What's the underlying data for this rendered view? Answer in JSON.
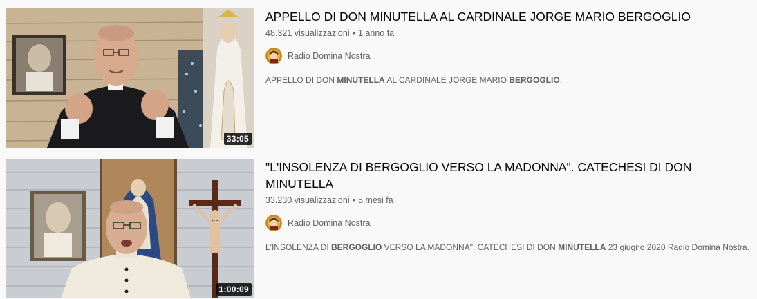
{
  "results": [
    {
      "title": "APPELLO DI DON MINUTELLA AL CARDINALE JORGE MARIO BERGOGLIO",
      "views": "48.321 visualizzazioni",
      "age": "1 anno fa",
      "separator": "•",
      "channel": "Radio Domina Nostra",
      "duration": "33:05",
      "description": [
        {
          "text": "APPELLO DI DON ",
          "bold": false
        },
        {
          "text": "MINUTELLA",
          "bold": true
        },
        {
          "text": " AL CARDINALE JORGE MARIO ",
          "bold": false
        },
        {
          "text": "BERGOGLIO",
          "bold": true
        },
        {
          "text": ".",
          "bold": false
        }
      ]
    },
    {
      "title": "\"L'INSOLENZA DI BERGOGLIO VERSO LA MADONNA\". CATECHESI DI DON MINUTELLA",
      "views": "33.230 visualizzazioni",
      "age": "5 mesi fa",
      "separator": "•",
      "channel": "Radio Domina Nostra",
      "duration": "1:00:09",
      "description": [
        {
          "text": "L'INSOLENZA DI ",
          "bold": false
        },
        {
          "text": "BERGOGLIO",
          "bold": true
        },
        {
          "text": " VERSO LA MADONNA\". CATECHESI DI DON ",
          "bold": false
        },
        {
          "text": "MINUTELLA",
          "bold": true
        },
        {
          "text": " 23 giugno 2020 Radio Domina Nostra.",
          "bold": false
        }
      ]
    }
  ]
}
